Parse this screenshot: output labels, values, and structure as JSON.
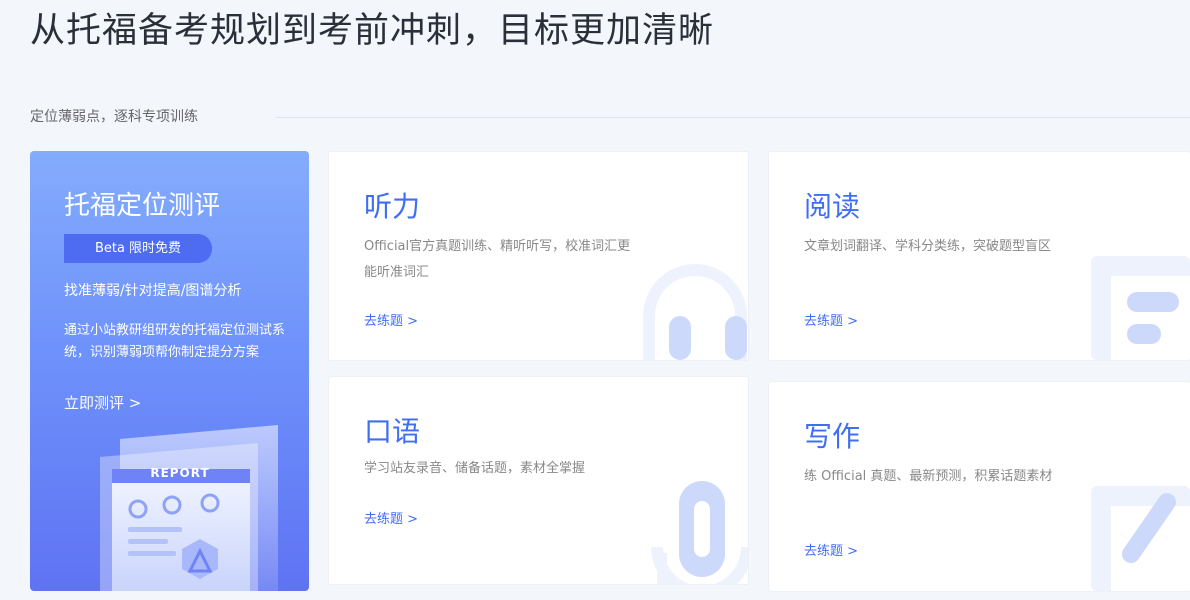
{
  "headline": "从托福备考规划到考前冲刺，目标更加清晰",
  "section_label": "定位薄弱点，逐科专项训练",
  "promo": {
    "title": "托福定位测评",
    "badge": "Beta 限时免费",
    "tagline": "找准薄弱/针对提高/图谱分析",
    "description": "通过小站教研组研发的托福定位测试系统，识别薄弱项帮你制定提分方案",
    "cta": "立即测评 >",
    "report_label": "REPORT"
  },
  "cards": {
    "listening": {
      "title": "听力",
      "description": "Official官方真题训练、精听听写，校准词汇更能听准词汇",
      "link": "去练题 >"
    },
    "reading": {
      "title": "阅读",
      "description": "文章划词翻译、学科分类练，突破题型盲区",
      "link": "去练题 >"
    },
    "speaking": {
      "title": "口语",
      "description": "学习站友录音、储备话题，素材全掌握",
      "link": "去练题 >"
    },
    "writing": {
      "title": "写作",
      "description": "练 Official 真题、最新预测，积累话题素材",
      "link": "去练题 >"
    }
  },
  "colors": {
    "accent": "#3f6ef6",
    "promo_top": "#84acfc",
    "promo_bottom": "#5f73f3",
    "deco": "#ccd9fb"
  },
  "icons": {
    "listening": "headphones-icon",
    "reading": "document-icon",
    "speaking": "microphone-icon",
    "writing": "pencil-icon"
  }
}
